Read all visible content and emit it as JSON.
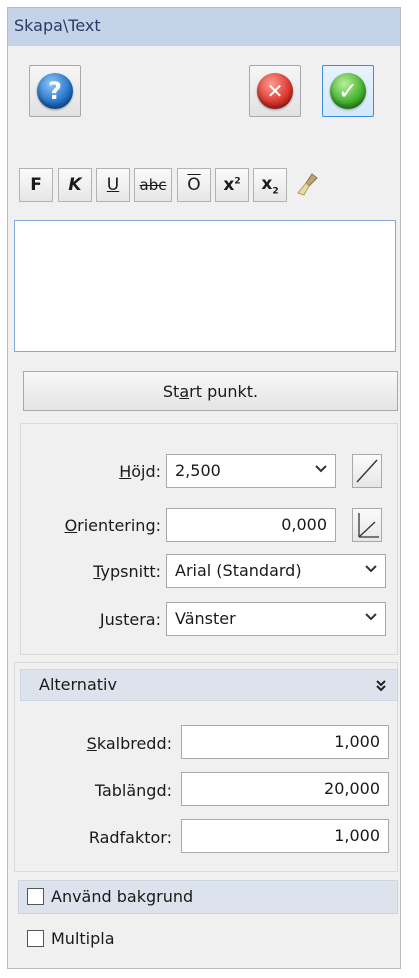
{
  "window": {
    "title": "Skapa\\Text"
  },
  "toolbar": {
    "help_icon": "question-icon",
    "cancel_icon": "cancel-x-icon",
    "ok_icon": "ok-check-icon",
    "help_glyph": "?",
    "cancel_glyph": "✕",
    "ok_glyph": "✓"
  },
  "format": {
    "bold": "F",
    "italic": "K",
    "underline": "U",
    "strikethrough": "abc",
    "overline": "O",
    "superscript": "x",
    "superscript_mark": "2",
    "subscript": "x",
    "subscript_mark": "2",
    "clear_icon": "brush-icon"
  },
  "text_input": {
    "value": ""
  },
  "start_point": {
    "label_pre": "St",
    "label_underline": "a",
    "label_post": "rt punkt."
  },
  "fields": {
    "height": {
      "label_underline": "H",
      "label_rest": "öjd:",
      "value": "2,500"
    },
    "orientation": {
      "label_underline": "O",
      "label_rest": "rientering:",
      "value": "0,000"
    },
    "font": {
      "label_underline": "T",
      "label_rest": "ypsnitt:",
      "value": "Arial (Standard)"
    },
    "align": {
      "label": "Justera:",
      "value": "Vänster"
    }
  },
  "alternatives": {
    "header": "Alternativ",
    "scale_width": {
      "label_underline": "S",
      "label_rest": "kalbredd:",
      "value": "1,000"
    },
    "tab_length": {
      "label": "Tablängd:",
      "value": "20,000"
    },
    "line_factor": {
      "label": "Radfaktor:",
      "value": "1,000"
    }
  },
  "options": {
    "use_background": {
      "label": "Använd bakgrund",
      "checked": false
    },
    "multiple": {
      "label": "Multipla",
      "checked": false
    }
  },
  "colors": {
    "title_bg": "#c5d3e8",
    "accent_border": "#3d8fdb",
    "help_blue": "#1f6fc6",
    "cancel_red": "#d9322a",
    "ok_green": "#3fae2a"
  }
}
